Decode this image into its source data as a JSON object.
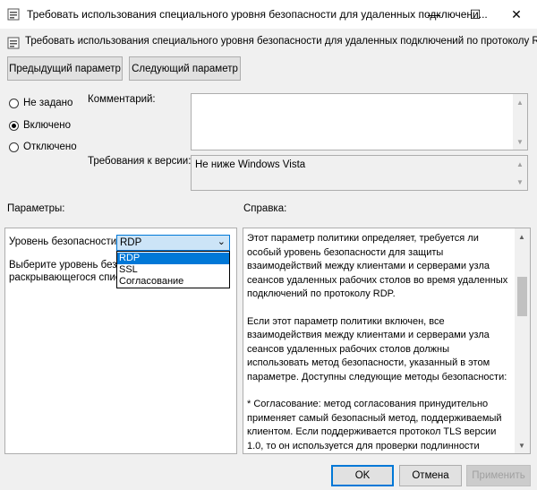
{
  "window": {
    "title": "Требовать использования специального уровня безопасности для удаленных подключени...",
    "minimize_glyph": "—",
    "maximize_glyph": "☐",
    "close_glyph": "✕"
  },
  "header": {
    "title": "Требовать использования специального уровня безопасности для удаленных подключений по протоколу RDP"
  },
  "nav": {
    "prev_label": "Предыдущий параметр",
    "next_label": "Следующий параметр"
  },
  "state": {
    "options": [
      "Не задано",
      "Включено",
      "Отключено"
    ],
    "selected": "Включено"
  },
  "comment": {
    "label": "Комментарий:",
    "value": ""
  },
  "version": {
    "label": "Требования к версии:",
    "value": "Не ниже Windows Vista"
  },
  "options_panel": {
    "title": "Параметры:",
    "security_label": "Уровень безопасности",
    "security_value": "RDP",
    "security_options": [
      "RDP",
      "SSL",
      "Согласование"
    ],
    "description_line1": "Выберите уровень безоп",
    "description_line2": "раскрывающегося списк"
  },
  "help_panel": {
    "title": "Справка:",
    "paragraphs": [
      "Этот параметр политики определяет, требуется ли особый уровень безопасности для защиты взаимодействий между клиентами и серверами узла сеансов удаленных рабочих столов во время удаленных подключений по протоколу RDP.",
      "Если этот параметр политики включен, все взаимодействия между клиентами и серверами узла сеансов удаленных рабочих столов должны использовать метод безопасности, указанный в этом параметре. Доступны следующие методы безопасности:",
      "* Согласование: метод согласования принудительно применяет самый безопасный метод, поддерживаемый клиентом. Если поддерживается протокол TLS версии 1.0, то он используется для проверки подлинности сервера узла сеансов удаленных рабочих столов. Если протокол TLS не поддерживается, то для обеспечения безопасности взаимодействий используется собственное шифрование"
    ]
  },
  "footer": {
    "ok_label": "OK",
    "cancel_label": "Отмена",
    "apply_label": "Применить"
  },
  "colors": {
    "accent": "#0078d7",
    "selection": "#cce4f7"
  }
}
